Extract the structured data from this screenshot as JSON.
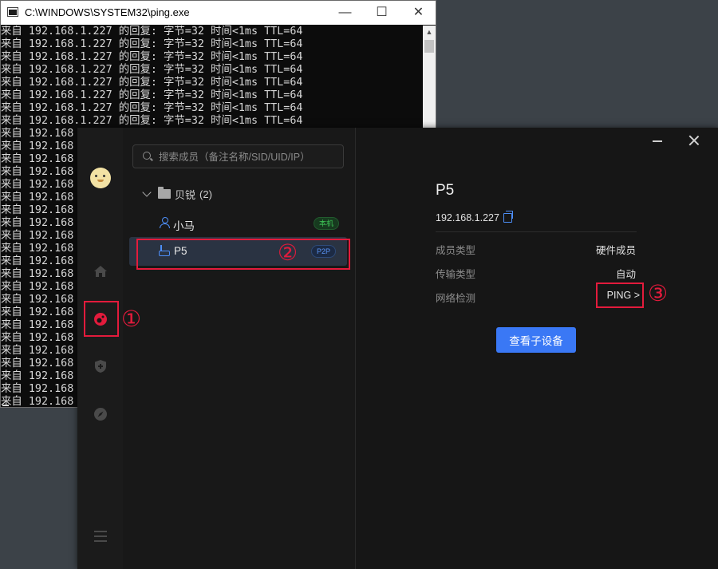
{
  "cmd": {
    "title": "C:\\WINDOWS\\SYSTEM32\\ping.exe",
    "controls": {
      "minimize": "—",
      "maximize": "☐",
      "close": "✕"
    },
    "lines": [
      "来自 192.168.1.227 的回复: 字节=32 时间<1ms TTL=64",
      "来自 192.168.1.227 的回复: 字节=32 时间<1ms TTL=64",
      "来自 192.168.1.227 的回复: 字节=32 时间<1ms TTL=64",
      "来自 192.168.1.227 的回复: 字节=32 时间<1ms TTL=64",
      "来自 192.168.1.227 的回复: 字节=32 时间<1ms TTL=64",
      "来自 192.168.1.227 的回复: 字节=32 时间<1ms TTL=64",
      "来自 192.168.1.227 的回复: 字节=32 时间<1ms TTL=64",
      "来自 192.168.1.227 的回复: 字节=32 时间<1ms TTL=64",
      "来自 192.168",
      "来自 192.168",
      "来自 192.168",
      "来自 192.168",
      "来自 192.168",
      "来自 192.168",
      "来自 192.168",
      "来自 192.168",
      "来自 192.168",
      "来自 192.168",
      "来自 192.168",
      "来自 192.168",
      "来自 192.168",
      "来自 192.168",
      "来自 192.168",
      "来自 192.168",
      "来自 192.168",
      "来自 192.168",
      "来自 192.168",
      "来自 192.168",
      "来自 192.168",
      "来自 192.168"
    ]
  },
  "app": {
    "nav_icons": [
      "avatar",
      "home-icon",
      "network-icon",
      "shield-icon",
      "compass-icon",
      "menu-icon"
    ],
    "search_placeholder": "搜索成员（备注名称/SID/UID/IP）",
    "group": {
      "name": "贝锐",
      "count": "(2)"
    },
    "members": [
      {
        "name": "小马",
        "badge": "本机",
        "icon": "user-icon"
      },
      {
        "name": "P5",
        "badge": "P2P",
        "icon": "router-icon"
      }
    ],
    "detail": {
      "name": "P5",
      "ip": "192.168.1.227",
      "rows": [
        {
          "label": "成员类型",
          "value": "硬件成员"
        },
        {
          "label": "传输类型",
          "value": "自动"
        },
        {
          "label": "网络检测",
          "value": "PING >"
        }
      ],
      "view_sub_button": "查看子设备"
    }
  },
  "annotations": [
    "①",
    "②",
    "③"
  ],
  "colors": {
    "accent": "#3a78f5",
    "annotation": "#e31b3c",
    "badge_green": "#3ec456"
  }
}
